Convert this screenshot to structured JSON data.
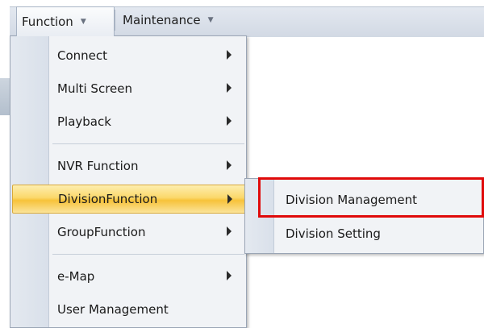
{
  "menubar": {
    "function_label": "Function",
    "maintenance_label": "Maintenance"
  },
  "menu": {
    "items": [
      {
        "label": "Connect",
        "has_submenu": true
      },
      {
        "label": "Multi Screen",
        "has_submenu": true
      },
      {
        "label": "Playback",
        "has_submenu": true
      },
      {
        "label": "NVR Function",
        "has_submenu": true
      },
      {
        "label": "DivisionFunction",
        "has_submenu": true,
        "highlighted": true
      },
      {
        "label": "GroupFunction",
        "has_submenu": true
      },
      {
        "label": "e-Map",
        "has_submenu": true
      },
      {
        "label": "User Management",
        "has_submenu": false
      }
    ]
  },
  "submenu": {
    "items": [
      {
        "label": "Division Management"
      },
      {
        "label": "Division Setting"
      }
    ]
  },
  "annotation": {
    "color": "#e00a0a",
    "target": "Division Management"
  },
  "colors": {
    "highlight": "#f9d25a",
    "menu_bg": "#f1f3f6",
    "gutter": "#dde3ec"
  }
}
